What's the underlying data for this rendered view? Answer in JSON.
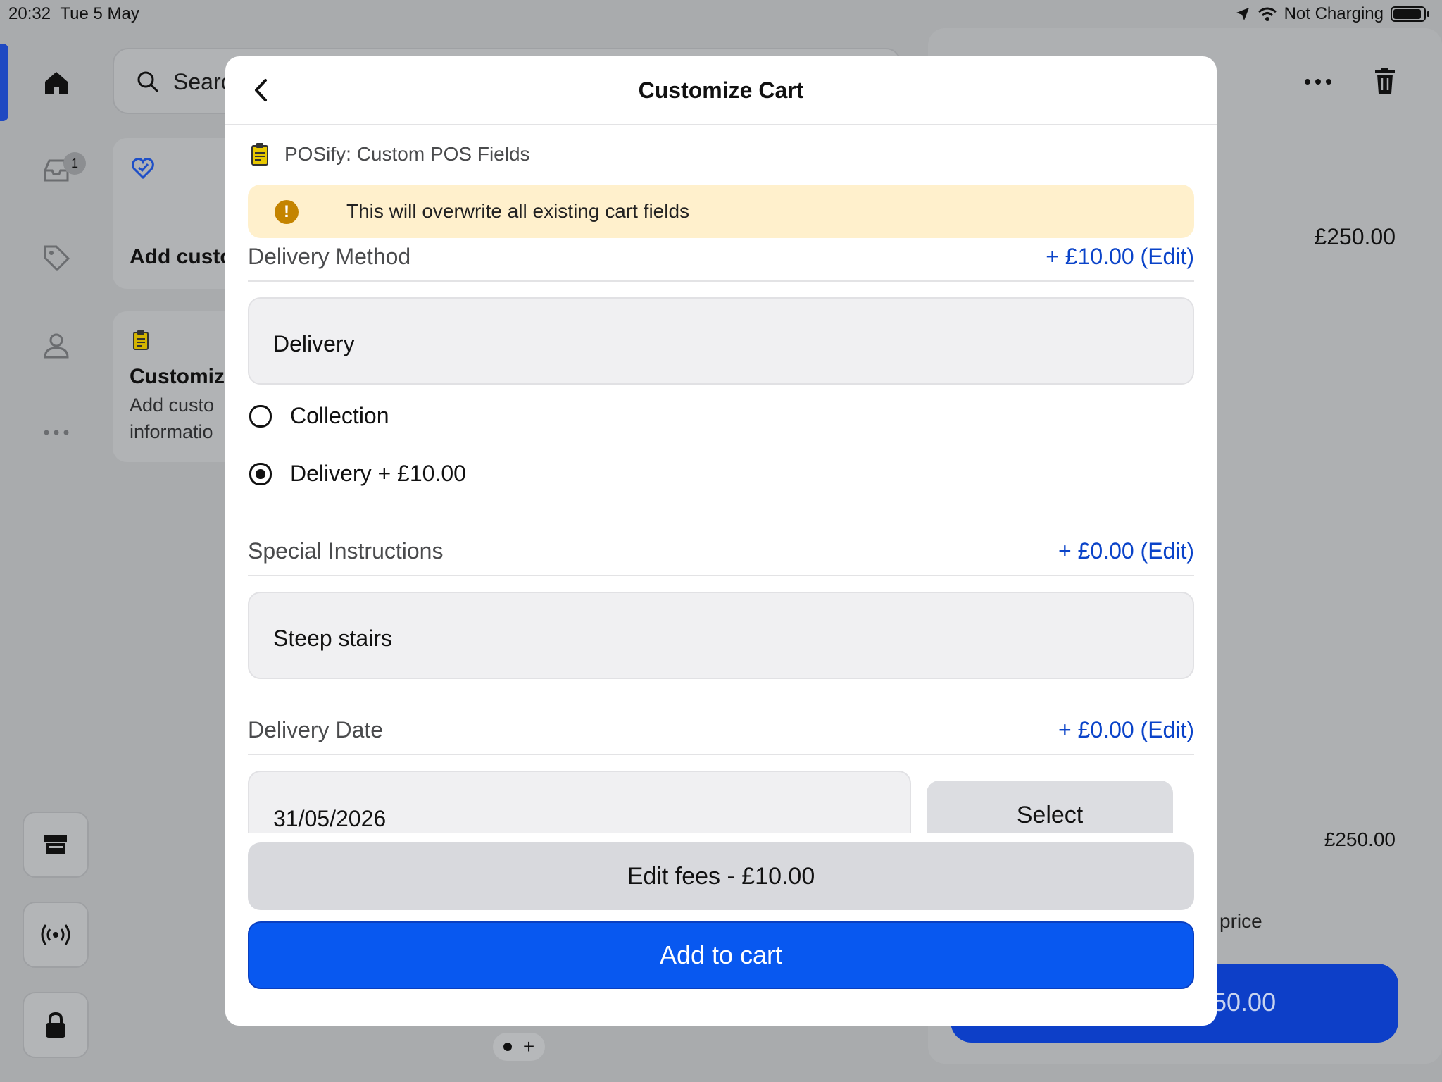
{
  "status_bar": {
    "time": "20:32",
    "date": "Tue 5 May",
    "battery_text": "Not Charging"
  },
  "background": {
    "search_placeholder": "Searc",
    "inbox_badge": "1",
    "card1_title": "Add custo",
    "card2_title": "Customiz",
    "card2_sub_line1": "Add custo",
    "card2_sub_line2": "informatio",
    "right_price_top": "£250.00",
    "right_price_bottom": "£250.00",
    "right_price_label": "price",
    "right_button_text": "50.00"
  },
  "modal": {
    "title": "Customize Cart",
    "app_name": "POSify: Custom POS Fields",
    "warning_text": "This will overwrite all existing cart fields",
    "delivery_method": {
      "label": "Delivery Method",
      "edit_link": "+ £10.00 (Edit)",
      "value": "Delivery",
      "options": [
        {
          "label": "Collection",
          "selected": false
        },
        {
          "label": "Delivery + £10.00",
          "selected": true
        }
      ]
    },
    "special_instructions": {
      "label": "Special Instructions",
      "edit_link": "+ £0.00 (Edit)",
      "value": "Steep stairs"
    },
    "delivery_date": {
      "label": "Delivery Date",
      "edit_link": "+ £0.00 (Edit)",
      "value": "31/05/2026",
      "select_label": "Select"
    },
    "edit_fees_label": "Edit fees - £10.00",
    "add_to_cart_label": "Add to cart"
  },
  "colors": {
    "accent": "#0858f0",
    "link": "#0a43c9",
    "warning_bg": "#fff0cc",
    "warning_icon": "#c48400"
  }
}
